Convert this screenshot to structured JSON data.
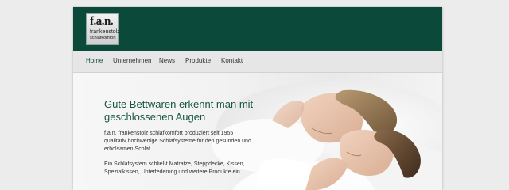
{
  "brand": {
    "mark": "f.a.n.",
    "line1": "frankenstolz",
    "line2": "schlafkomfort"
  },
  "nav": {
    "items": [
      {
        "label": "Home"
      },
      {
        "label": "Unternehmen"
      },
      {
        "label": "News"
      },
      {
        "label": "Produkte"
      },
      {
        "label": "Kontakt"
      }
    ],
    "active": "Home"
  },
  "hero": {
    "title": "Gute Bettwaren erkennt man mit geschlossenen Augen",
    "paragraph1": "f.a.n. frankenstolz schlafkomfort produziert seit 1955 qualitativ hochwertige Schlafsysteme für den gesunden und erholsamen Schlaf.",
    "paragraph2": "Ein Schlafsystem schließt Matratze, Steppdecke, Kissen, Spezialkissen, Unterfederung und weitere Produkte ein."
  },
  "colors": {
    "header_bg": "#0b4a3a",
    "title_color": "#16563f",
    "nav_bg": "#e6e6e6",
    "page_bg": "#ececec"
  }
}
